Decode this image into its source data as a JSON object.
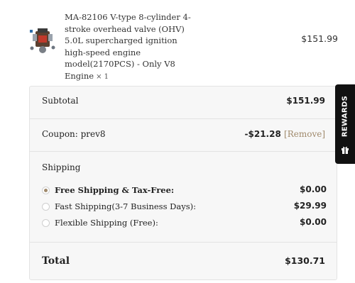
{
  "product": {
    "title": "MA-82106 V-type 8-cylinder 4-stroke overhead valve (OHV) 5.0L supercharged ignition high-speed engine model(2170PCS) - Only V8 Engine",
    "quantity": "× 1",
    "price": "$151.99",
    "image_icon": "engine-model-thumbnail"
  },
  "summary": {
    "subtotal_label": "Subtotal",
    "subtotal_value": "$151.99",
    "coupon_label": "Coupon: prev8",
    "coupon_value": "-$21.28",
    "coupon_remove": "[Remove]",
    "shipping_label": "Shipping",
    "shipping_options": [
      {
        "label": "Free Shipping & Tax-Free:",
        "price": "$0.00",
        "selected": true
      },
      {
        "label": "Fast Shipping(3-7 Business Days):",
        "price": "$29.99",
        "selected": false
      },
      {
        "label": "Flexible Shipping (Free):",
        "price": "$0.00",
        "selected": false
      }
    ],
    "total_label": "Total",
    "total_value": "$130.71"
  },
  "rewards": {
    "label": "REWARDS",
    "icon": "gift-icon"
  },
  "colors": {
    "accent": "#a08a6c",
    "panel_bg": "#f7f7f7",
    "rewards_bg": "#111111"
  }
}
